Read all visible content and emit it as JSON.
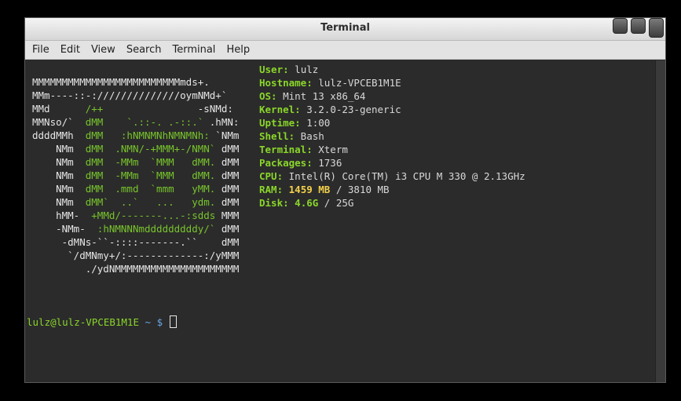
{
  "window": {
    "title": "Terminal"
  },
  "menu": [
    "File",
    "Edit",
    "View",
    "Search",
    "Terminal",
    "Help"
  ],
  "logo": [
    [
      {
        "t": "MMMMMMMMMMMMMMMMMMMMMMMMMmds+.",
        "g": false
      }
    ],
    [
      {
        "t": "MMm----::-://////////////oymNMd+`",
        "g": false
      }
    ],
    [
      {
        "t": "MMd      ",
        "g": false
      },
      {
        "t": "/++",
        "g": true
      },
      {
        "t": "                -sNMd:",
        "g": false
      }
    ],
    [
      {
        "t": "MMNso/`  ",
        "g": false
      },
      {
        "t": "dMM    `.::-. .-::.`",
        "g": true
      },
      {
        "t": " .hMN:",
        "g": false
      }
    ],
    [
      {
        "t": "ddddMMh  ",
        "g": false
      },
      {
        "t": "dMM   :hNMNMNhNMNMNh:",
        "g": true
      },
      {
        "t": " `NMm",
        "g": false
      }
    ],
    [
      {
        "t": "    NMm  ",
        "g": false
      },
      {
        "t": "dMM  .NMN/-+MMM+-/NMN`",
        "g": true
      },
      {
        "t": " dMM",
        "g": false
      }
    ],
    [
      {
        "t": "    NMm  ",
        "g": false
      },
      {
        "t": "dMM  -MMm  `MMM   dMM.",
        "g": true
      },
      {
        "t": " dMM",
        "g": false
      }
    ],
    [
      {
        "t": "    NMm  ",
        "g": false
      },
      {
        "t": "dMM  -MMm  `MMM   dMM.",
        "g": true
      },
      {
        "t": " dMM",
        "g": false
      }
    ],
    [
      {
        "t": "    NMm  ",
        "g": false
      },
      {
        "t": "dMM  .mmd  `mmm   yMM.",
        "g": true
      },
      {
        "t": " dMM",
        "g": false
      }
    ],
    [
      {
        "t": "    NMm  ",
        "g": false
      },
      {
        "t": "dMM`  ..`   ...   ydm.",
        "g": true
      },
      {
        "t": " dMM",
        "g": false
      }
    ],
    [
      {
        "t": "    hMM-  ",
        "g": false
      },
      {
        "t": "+MMd/-------...-:sdds",
        "g": true
      },
      {
        "t": " MMM",
        "g": false
      }
    ],
    [
      {
        "t": "    -NMm-  ",
        "g": false
      },
      {
        "t": ":hNMNNNmdddddddddy/`",
        "g": true
      },
      {
        "t": " dMM",
        "g": false
      }
    ],
    [
      {
        "t": "     -dMNs-``-::::-------.``",
        "g": false
      },
      {
        "t": "    dMM",
        "g": false
      }
    ],
    [
      {
        "t": "      `/dMNmy+/:-------------:/yMMM",
        "g": false
      }
    ],
    [
      {
        "t": "         ./ydNMMMMMMMMMMMMMMMMMMMMM",
        "g": false
      }
    ]
  ],
  "info": {
    "user": {
      "label": "User:",
      "value": " lulz"
    },
    "hostname": {
      "label": "Hostname:",
      "value": " lulz-VPCEB1M1E"
    },
    "os": {
      "label": "OS:",
      "value": " Mint 13 x86_64"
    },
    "kernel": {
      "label": "Kernel:",
      "value": " 3.2.0-23-generic"
    },
    "uptime": {
      "label": "Uptime:",
      "value": " 1:00"
    },
    "shell": {
      "label": "Shell:",
      "value": " Bash"
    },
    "terminal": {
      "label": "Terminal:",
      "value": " Xterm"
    },
    "packages": {
      "label": "Packages:",
      "value": " 1736"
    },
    "cpu": {
      "label": "CPU:",
      "value": " Intel(R) Core(TM) i3 CPU M 330 @ 2.13GHz"
    },
    "ram": {
      "label": "RAM:",
      "used": "1459 MB",
      "rest": " / 3810 MB"
    },
    "disk": {
      "label": "Disk:",
      "used": "4.6G",
      "rest": " / 25G"
    }
  },
  "prompt": {
    "user_host": "lulz@lulz-VPCEB1M1E",
    "path": " ~ ",
    "symbol": "$ "
  }
}
